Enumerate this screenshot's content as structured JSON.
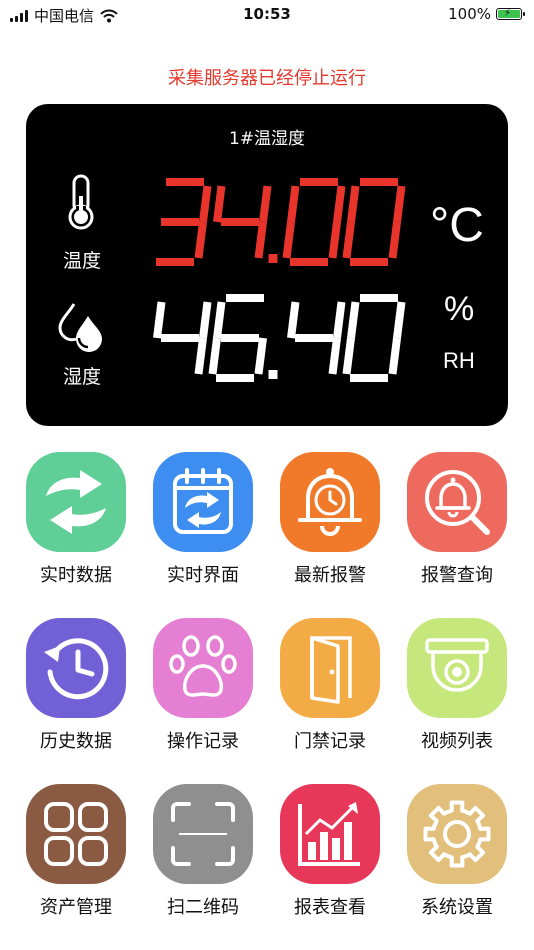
{
  "status_bar": {
    "carrier": "中国电信",
    "time": "10:53",
    "battery": "100%"
  },
  "notice": "采集服务器已经停止运行",
  "sensor_panel": {
    "title": "1#温湿度",
    "temperature": {
      "label": "温度",
      "value": "34.00",
      "unit": "°C",
      "color": "#e8342b"
    },
    "humidity": {
      "label": "湿度",
      "value": "46.40",
      "unit": "%",
      "unit_sub": "RH",
      "color": "#ffffff"
    }
  },
  "apps": [
    {
      "label": "实时数据",
      "icon": "refresh-icon",
      "color": "#5fcf97"
    },
    {
      "label": "实时界面",
      "icon": "calendar-sync-icon",
      "color": "#3d8ef0"
    },
    {
      "label": "最新报警",
      "icon": "alarm-clock-bell-icon",
      "color": "#f07a2a"
    },
    {
      "label": "报警查询",
      "icon": "bell-search-icon",
      "color": "#ef6a5e"
    },
    {
      "label": "历史数据",
      "icon": "history-clock-icon",
      "color": "#7160d6"
    },
    {
      "label": "操作记录",
      "icon": "paw-icon",
      "color": "#e47fd3"
    },
    {
      "label": "门禁记录",
      "icon": "door-icon",
      "color": "#f3ac45"
    },
    {
      "label": "视频列表",
      "icon": "camera-dome-icon",
      "color": "#c6e77b"
    },
    {
      "label": "资产管理",
      "icon": "grid-icon",
      "color": "#8a5a42"
    },
    {
      "label": "扫二维码",
      "icon": "scan-icon",
      "color": "#8f8f8f"
    },
    {
      "label": "报表查看",
      "icon": "chart-icon",
      "color": "#e8385a"
    },
    {
      "label": "系统设置",
      "icon": "gear-icon",
      "color": "#e2c07c"
    }
  ]
}
